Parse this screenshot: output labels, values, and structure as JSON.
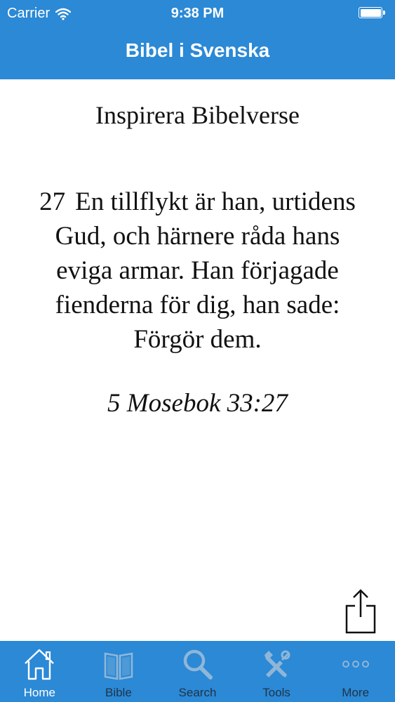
{
  "status_bar": {
    "carrier": "Carrier",
    "time": "9:38 PM",
    "wifi_icon": "wifi-icon",
    "battery_icon": "battery-icon"
  },
  "nav": {
    "title": "Bibel i Svenska"
  },
  "main": {
    "heading": "Inspirera Bibelverse",
    "verse_number": "27",
    "verse_text": "En tillflykt är han, urtidens Gud, och härnere råda hans eviga armar. Han förjagade fienderna för dig, han sade: Förgör dem.",
    "reference": "5 Mosebok 33:27",
    "share_icon": "share-icon"
  },
  "tab_bar": {
    "tabs": [
      {
        "label": "Home",
        "icon": "home-icon",
        "active": true
      },
      {
        "label": "Bible",
        "icon": "book-icon",
        "active": false
      },
      {
        "label": "Search",
        "icon": "search-icon",
        "active": false
      },
      {
        "label": "Tools",
        "icon": "tools-icon",
        "active": false
      },
      {
        "label": "More",
        "icon": "more-icon",
        "active": false
      }
    ]
  },
  "colors": {
    "accent": "#2b89d6",
    "text": "#111111",
    "tab_active": "#ffffff",
    "tab_inactive_icon": "#8fb6d8",
    "tab_inactive_label": "#1f3347"
  }
}
